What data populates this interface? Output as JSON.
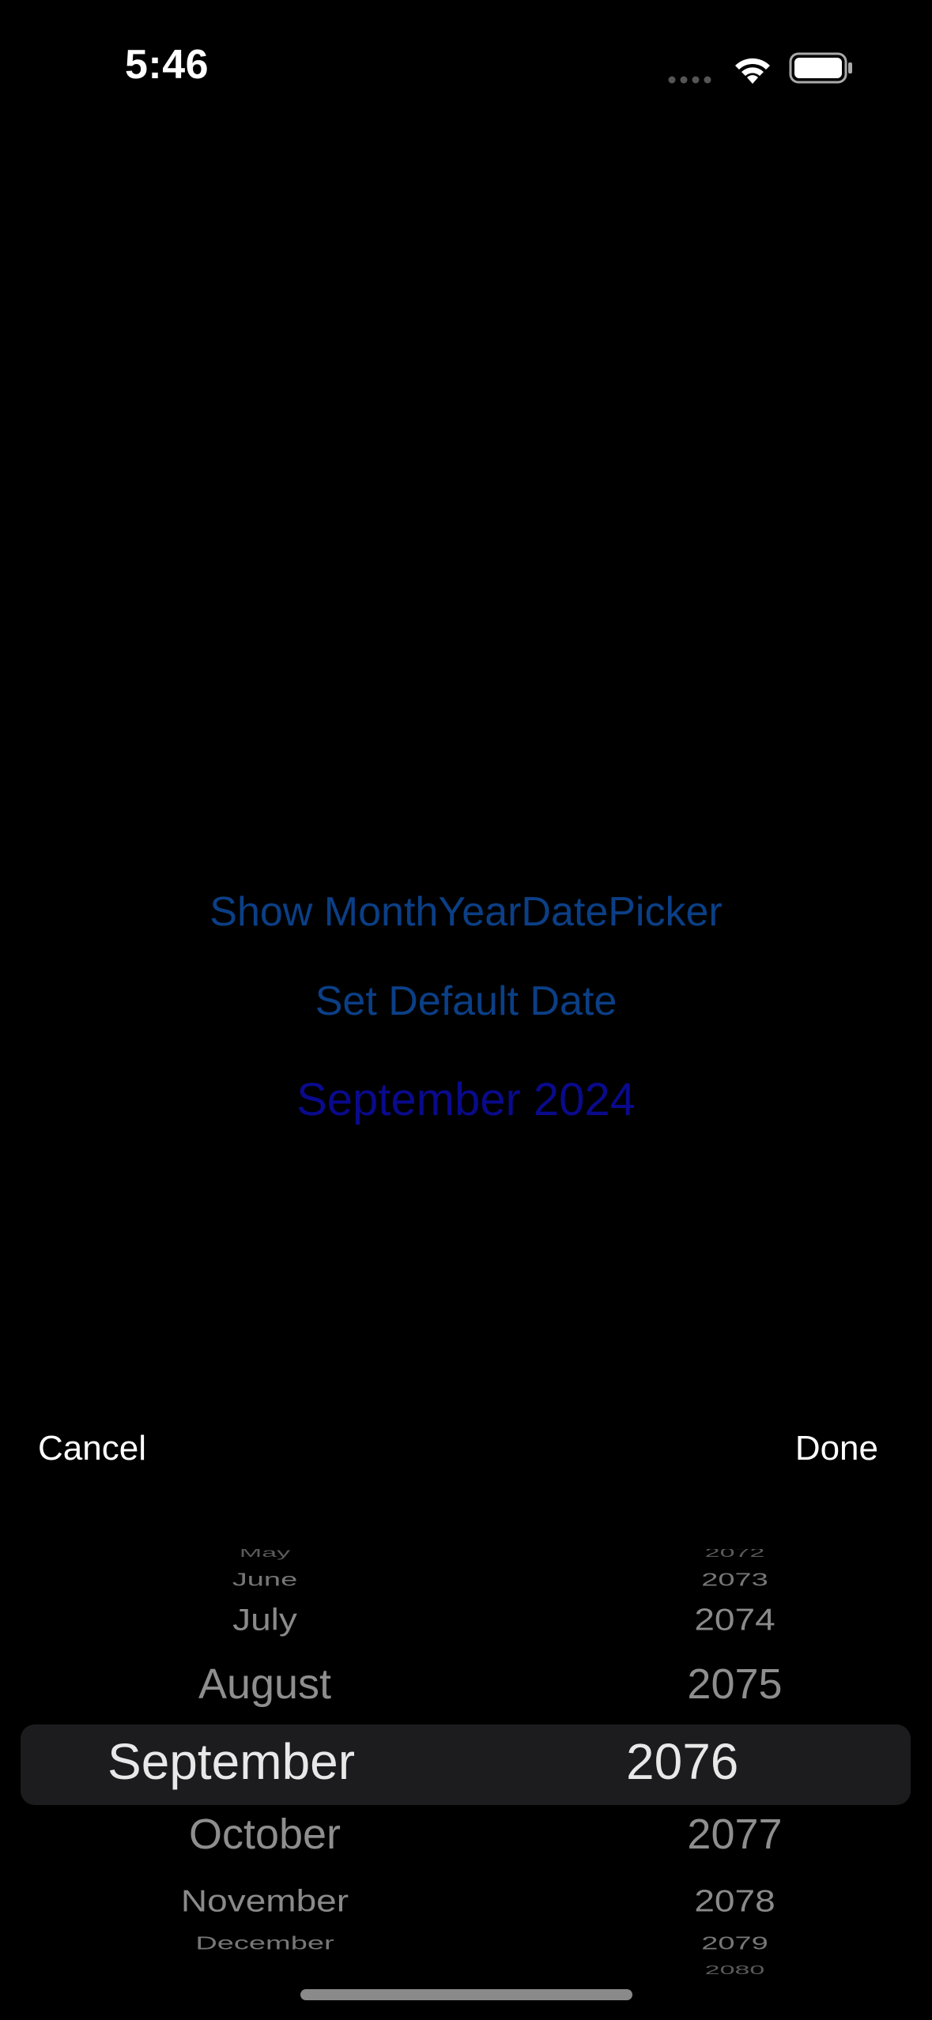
{
  "status_bar": {
    "time": "5:46"
  },
  "main": {
    "show_picker_label": "Show MonthYearDatePicker",
    "set_default_label": "Set Default Date",
    "selected_date": "September 2024"
  },
  "toolbar": {
    "cancel_label": "Cancel",
    "done_label": "Done"
  },
  "picker": {
    "months": {
      "far_top": "May",
      "top2": "June",
      "top1": "July",
      "prev": "August",
      "selected": "September",
      "next": "October",
      "bot1": "November",
      "bot2": "December",
      "far_bot": ""
    },
    "years": {
      "far_top": "2072",
      "top2": "2073",
      "top1": "2074",
      "prev": "2075",
      "selected": "2076",
      "next": "2077",
      "bot1": "2078",
      "bot2": "2079",
      "far_bot": "2080"
    }
  },
  "colors": {
    "background": "#000000",
    "link_blue": "#0b3f86",
    "date_blue": "#0a0a8c",
    "selection_band": "#1c1c1e"
  }
}
